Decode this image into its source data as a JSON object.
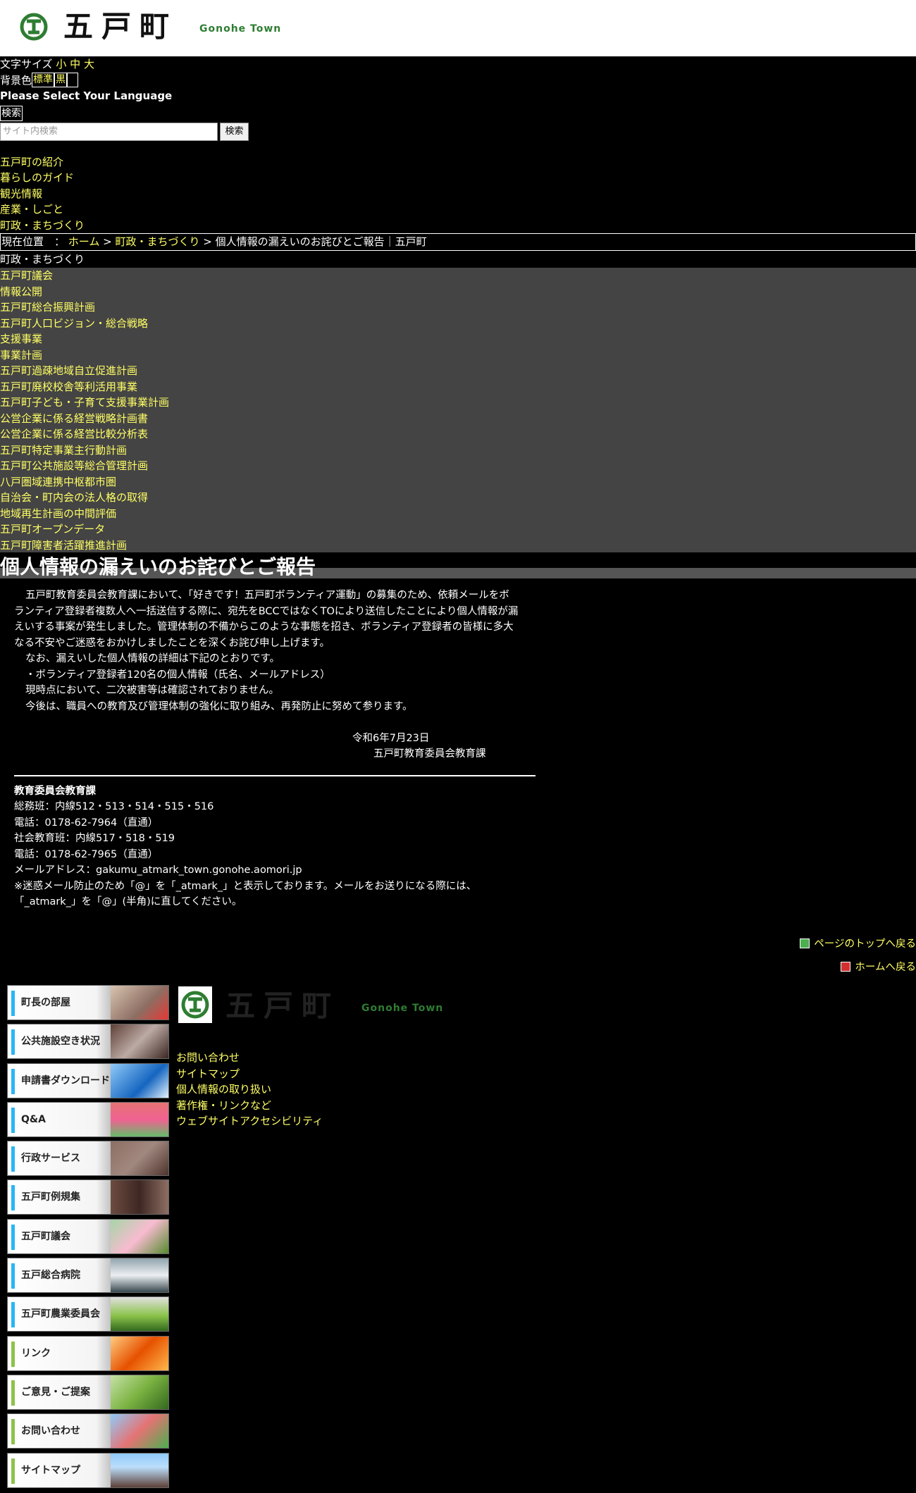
{
  "header": {
    "logo_kanji": "五戸町",
    "logo_roman": "Gonohe Town"
  },
  "util": {
    "font_size_label": "文字サイズ",
    "font_sizes": [
      "小",
      "中",
      "大"
    ],
    "bg_label": "背景色",
    "bg_options": [
      "標準",
      "黒",
      ""
    ],
    "language": "Please Select Your Language",
    "search_toggle": "検索",
    "search_placeholder": "サイト内検索",
    "search_button": "検索"
  },
  "gnav": [
    "五戸町の紹介",
    "暮らしのガイド",
    "観光情報",
    "産業・しごと",
    "町政・まちづくり"
  ],
  "breadcrumb": {
    "label": "現在位置　：",
    "home": "ホーム",
    "sep1": ">",
    "parent": "町政・まちづくり",
    "sep2": ">",
    "current": "個人情報の漏えいのお詫びとご報告｜五戸町"
  },
  "section_title": "町政・まちづくり",
  "subnav": [
    "五戸町議会",
    "情報公開",
    "五戸町総合振興計画",
    "五戸町人口ビジョン・総合戦略",
    "支援事業",
    "事業計画",
    "五戸町過疎地域自立促進計画",
    "五戸町廃校校舎等利活用事業",
    "五戸町子ども・子育て支援事業計画",
    "公営企業に係る経営戦略計画書",
    "公営企業に係る経営比較分析表",
    "五戸町特定事業主行動計画",
    "五戸町公共施設等総合管理計画",
    "八戸圏域連携中枢都市圏",
    "自治会・町内会の法人格の取得",
    "地域再生計画の中間評価",
    "五戸町オープンデータ",
    "五戸町障害者活躍推進計画"
  ],
  "page_title": "個人情報の漏えいのお詫びとご報告",
  "body": {
    "p1_1": "五戸町教育委員会教育課において、「好きです！五戸町ボランティア運動」の募集のため、依頼メールをボ",
    "p1_2": "ランティア登録者複数人へ一括送信する際に、宛先をBCCではなくTOにより送信したことにより個人情報が漏",
    "p1_3": "えいする事案が発生しました。管理体制の不備からこのような事態を招き、ボランティア登録者の皆様に多大",
    "p1_4": "なる不安やご迷惑をおかけしましたことを深くお詫び申し上げます。",
    "p2": "なお、漏えいした個人情報の詳細は下記のとおりです。",
    "p3": "・ボランティア登録者120名の個人情報（氏名、メールアドレス）",
    "p4": "現時点において、二次被害等は確認されておりません。",
    "p5": "今後は、職員への教育及び管理体制の強化に取り組み、再発防止に努めて参ります。",
    "date": "令和6年7月23日",
    "signer": "五戸町教育委員会教育課"
  },
  "contact": {
    "title": "教育委員会教育課",
    "line1": "総務班：内線512・513・514・515・516",
    "line2": "電話：0178-62-7964（直通）",
    "line3": "社会教育班：内線517・518・519",
    "line4": "電話：0178-62-7965（直通）",
    "line5": "メールアドレス：gakumu_atmark_town.gonohe.aomori.jp",
    "line6": "※迷惑メール防止のため「@」を「_atmark_」と表示しております。メールをお送りになる際には、",
    "line7": "「_atmark_」を「@」(半角)に直してください。"
  },
  "pagetop": "ページのトップへ戻る",
  "home_link": "ホームへ戻る",
  "banners": [
    "町長の部屋",
    "公共施設空き状況",
    "申請書ダウンロード",
    "Q&A",
    "行政サービス",
    "五戸町例規集",
    "五戸町議会",
    "五戸総合病院",
    "五戸町農業委員会",
    "リンク",
    "ご意見・ご提案",
    "お問い合わせ",
    "サイトマップ"
  ],
  "footer_logo": {
    "kanji": "五戸町",
    "roman": "Gonohe Town"
  },
  "footer_links": [
    "お問い合わせ",
    "サイトマップ",
    "個人情報の取り扱い",
    "著作権・リンクなど",
    "ウェブサイトアクセシビリティ"
  ],
  "colors": {
    "link": "#ffff66",
    "background": "#000000",
    "subnav_bg": "#444444",
    "brand_green": "#2e7d32"
  }
}
